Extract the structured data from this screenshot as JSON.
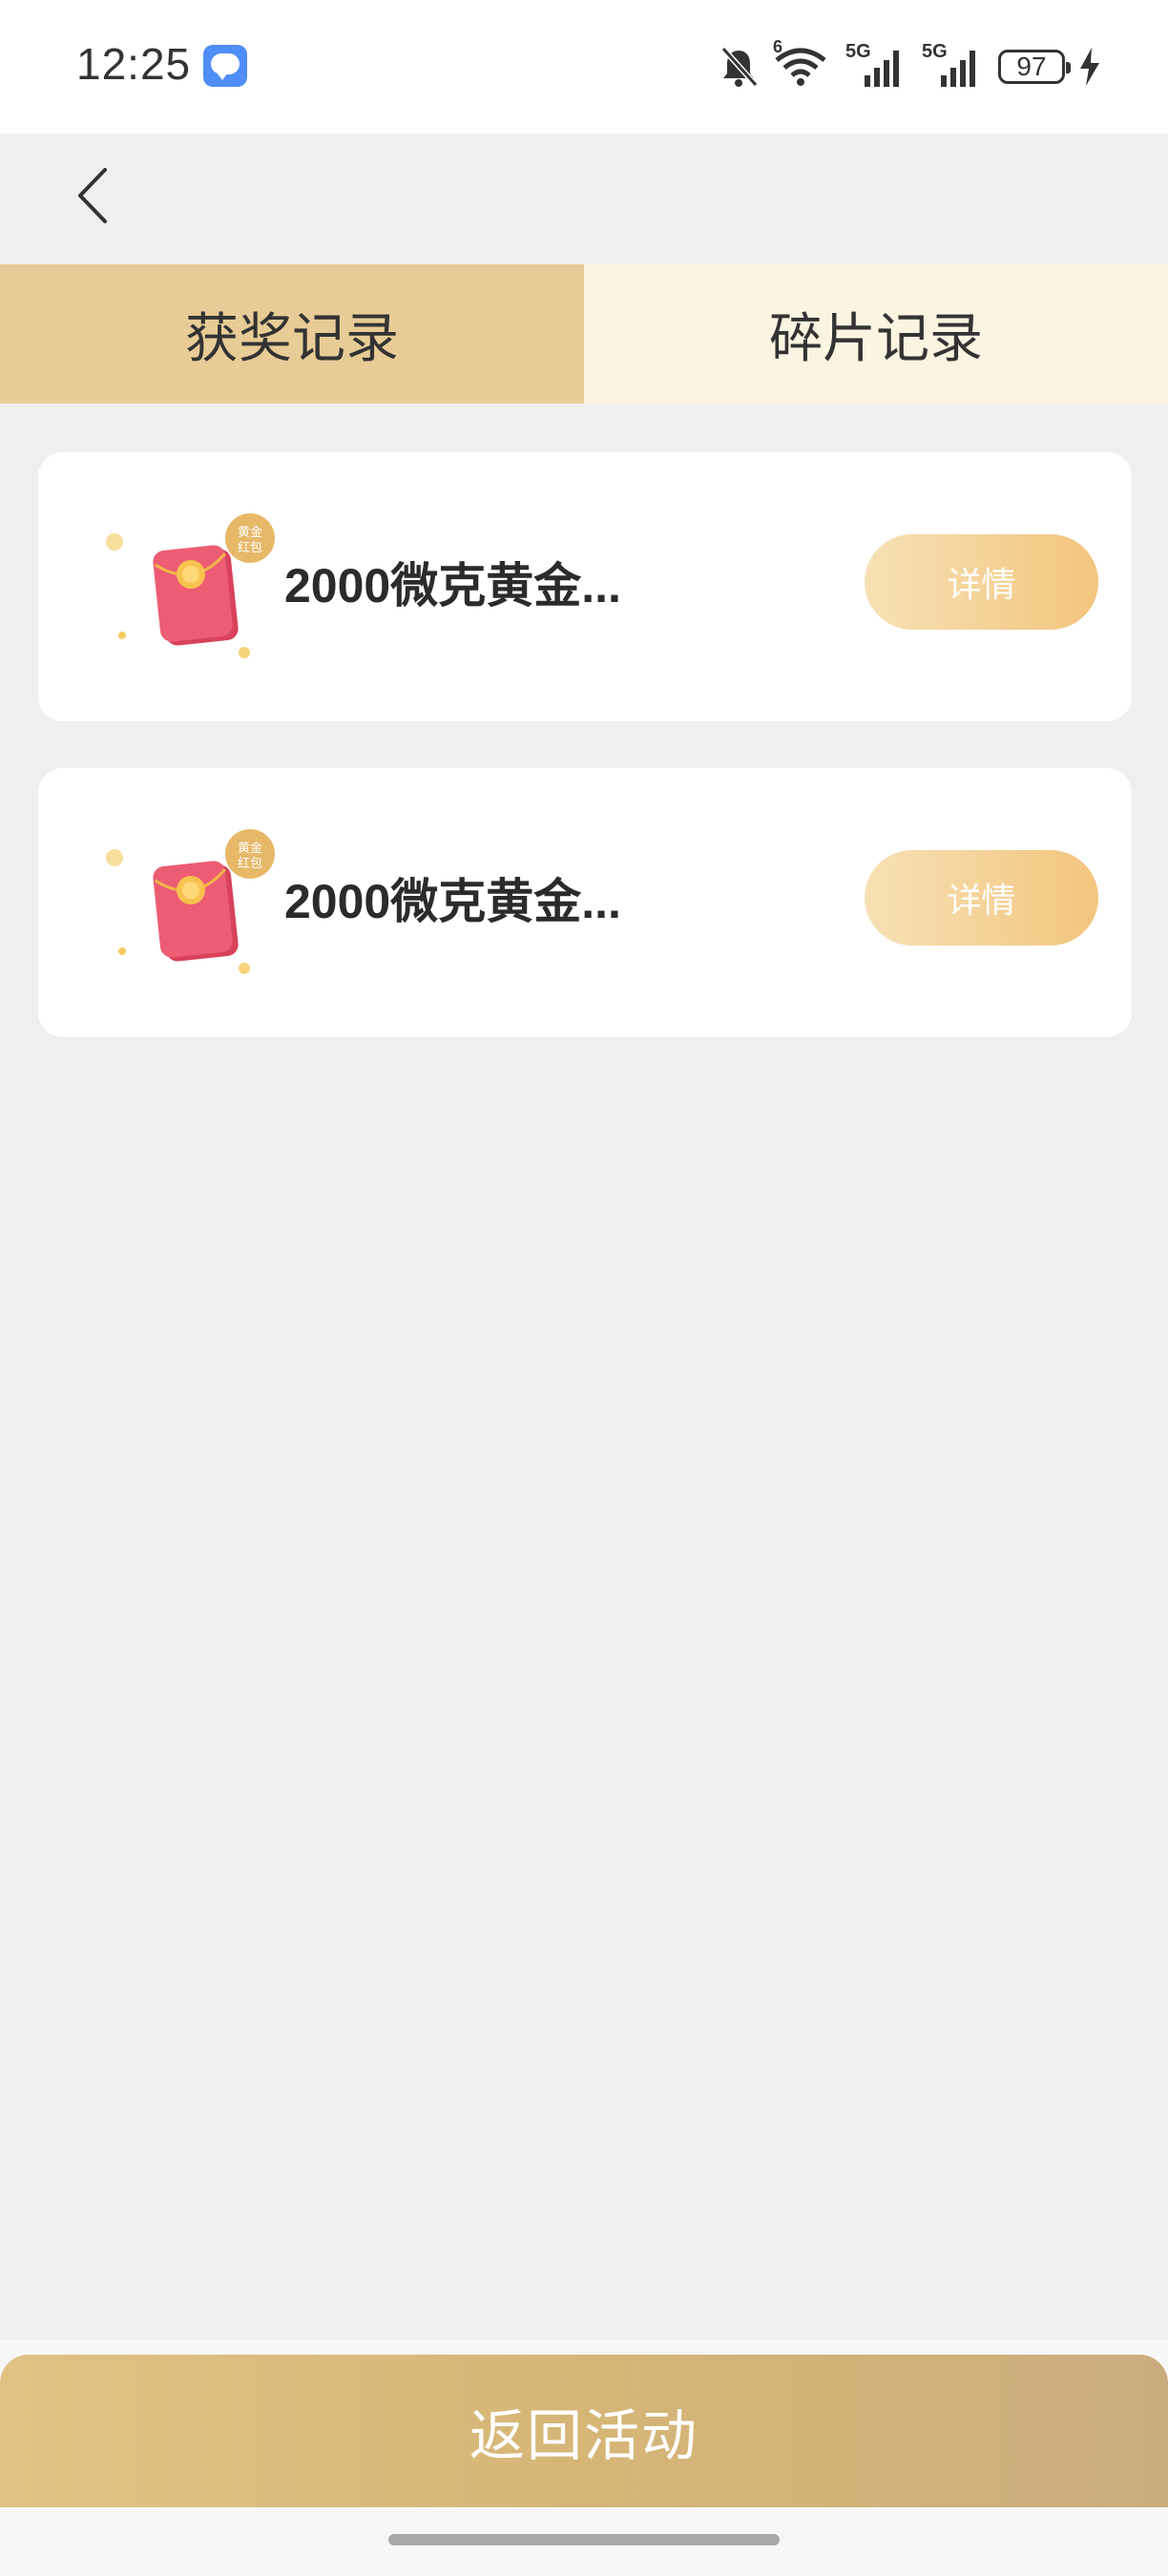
{
  "status_bar": {
    "time": "12:25",
    "battery": "97",
    "network_1": "5G",
    "network_2": "5G",
    "wifi_sub": "6"
  },
  "tabs": [
    {
      "label": "获奖记录",
      "active": true
    },
    {
      "label": "碎片记录",
      "active": false
    }
  ],
  "records": [
    {
      "title": "2000微克黄金...",
      "badge": "黄金\n红包",
      "button": "详情"
    },
    {
      "title": "2000微克黄金...",
      "badge": "黄金\n红包",
      "button": "详情"
    }
  ],
  "bottom": {
    "return_label": "返回活动"
  },
  "colors": {
    "active_tab": "#e8cc96",
    "inactive_tab": "#fbf4e2",
    "detail_button_start": "#f6e1b5",
    "detail_button_end": "#f3c57e",
    "return_button": "#d6b677",
    "page_bg": "#efefef"
  }
}
